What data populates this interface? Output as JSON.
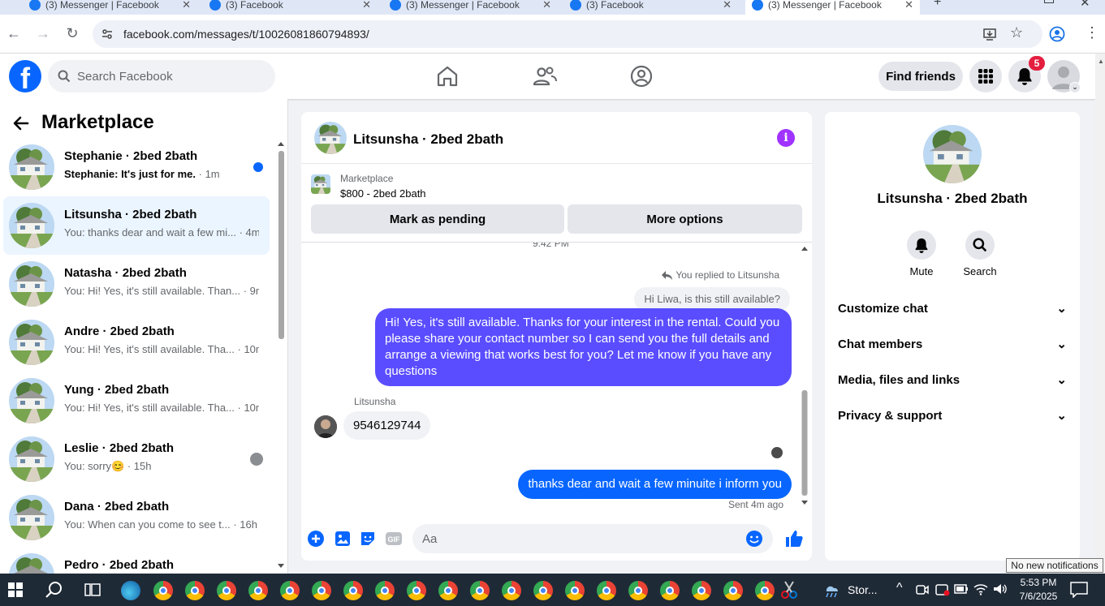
{
  "browser": {
    "tabs": [
      {
        "label": "(3) Messenger | Facebook",
        "active": false
      },
      {
        "label": "(3) Facebook",
        "active": false
      },
      {
        "label": "(3) Messenger | Facebook",
        "active": false
      },
      {
        "label": "(3) Facebook",
        "active": false
      },
      {
        "label": "(3) Messenger | Facebook",
        "active": true
      }
    ],
    "url": "facebook.com/messages/t/10026081860794893/"
  },
  "fb_header": {
    "logo": "f",
    "search_placeholder": "Search Facebook",
    "find_friends": "Find friends",
    "notification_count": "5"
  },
  "left_panel": {
    "title": "Marketplace",
    "conversations": [
      {
        "name": "Stephanie · 2bed 2bath",
        "preview": "Stephanie: It's just for me.",
        "time": " · 1m",
        "unread": true
      },
      {
        "name": "Litsunsha · 2bed 2bath",
        "preview": "You: thanks dear and wait a few mi...",
        "time": " · 4m",
        "selected": true
      },
      {
        "name": "Natasha · 2bed 2bath",
        "preview": "You: Hi! Yes, it's still available. Than...",
        "time": " · 9m"
      },
      {
        "name": "Andre · 2bed 2bath",
        "preview": "You: Hi! Yes, it's still available. Tha...",
        "time": " · 10m"
      },
      {
        "name": "Yung · 2bed 2bath",
        "preview": "You: Hi! Yes, it's still available. Tha...",
        "time": " · 10m"
      },
      {
        "name": "Leslie · 2bed 2bath",
        "preview": "You: sorry😊",
        "time": " · 15h"
      },
      {
        "name": "Dana · 2bed 2bath",
        "preview": "You: When can you come to see t...",
        "time": " · 16h"
      },
      {
        "name": "Pedro · 2bed 2bath",
        "preview": "",
        "time": ""
      }
    ]
  },
  "chat": {
    "title": "Litsunsha · 2bed 2bath",
    "marketplace_label": "Marketplace",
    "listing": "$800 - 2bed 2bath",
    "mark_pending": "Mark as pending",
    "more_options": "More options",
    "time_cut": "9:42 PM",
    "replied_to": "You replied to Litsunsha",
    "quoted": "Hi Liwa, is this still available?",
    "outgoing_1": "Hi!  Yes, it's still available. Thanks for your interest in the rental. Could you please share your contact number so I can send you the full details and arrange a viewing that works best for you? Let me know if you have any questions",
    "sender": "Litsunsha",
    "incoming_1": "9546129744",
    "outgoing_2": "thanks dear and wait a few minuite i inform you",
    "sent_status": "Sent 4m ago",
    "composer_placeholder": "Aa"
  },
  "right_panel": {
    "name": "Litsunsha · 2bed 2bath",
    "mute": "Mute",
    "search": "Search",
    "rows": [
      "Customize chat",
      "Chat members",
      "Media, files and links",
      "Privacy & support"
    ]
  },
  "tooltip": "No new notifications",
  "taskbar": {
    "weather": "Stor...",
    "time": "5:53 PM",
    "date": "7/6/2025"
  },
  "colors": {
    "fb_blue": "#0866ff",
    "outgoing_bubble": "#5a4dff",
    "info_purple": "#a033ff"
  }
}
